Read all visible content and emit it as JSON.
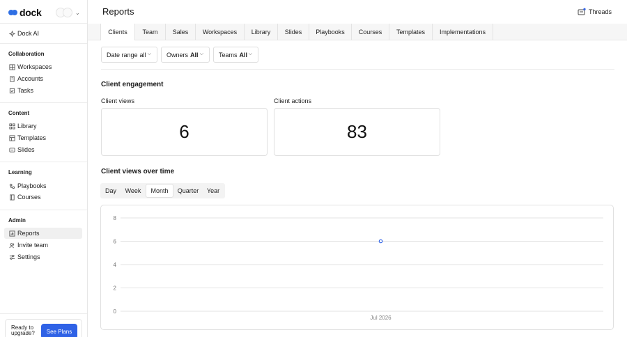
{
  "brand": {
    "name": "dock"
  },
  "sidebar": {
    "top_items": [
      {
        "label": "Dock AI",
        "icon": "sparkle-icon"
      }
    ],
    "sections": [
      {
        "heading": "Collaboration",
        "items": [
          {
            "label": "Workspaces",
            "icon": "grid-icon"
          },
          {
            "label": "Accounts",
            "icon": "building-icon"
          },
          {
            "label": "Tasks",
            "icon": "checkbox-icon"
          }
        ]
      },
      {
        "heading": "Content",
        "items": [
          {
            "label": "Library",
            "icon": "grid-icon"
          },
          {
            "label": "Templates",
            "icon": "template-icon"
          },
          {
            "label": "Slides",
            "icon": "slides-icon"
          }
        ]
      },
      {
        "heading": "Learning",
        "items": [
          {
            "label": "Playbooks",
            "icon": "playbook-icon"
          },
          {
            "label": "Courses",
            "icon": "book-icon"
          }
        ]
      },
      {
        "heading": "Admin",
        "items": [
          {
            "label": "Reports",
            "icon": "chart-icon",
            "active": true
          },
          {
            "label": "Invite team",
            "icon": "users-icon"
          },
          {
            "label": "Settings",
            "icon": "sliders-icon"
          }
        ]
      }
    ],
    "upgrade": {
      "text": "Ready to upgrade?",
      "button": "See Plans"
    }
  },
  "header": {
    "title": "Reports",
    "threads_label": "Threads"
  },
  "tabs": [
    {
      "label": "Clients",
      "active": true
    },
    {
      "label": "Team"
    },
    {
      "label": "Sales"
    },
    {
      "label": "Workspaces"
    },
    {
      "label": "Library"
    },
    {
      "label": "Slides"
    },
    {
      "label": "Playbooks"
    },
    {
      "label": "Courses"
    },
    {
      "label": "Templates"
    },
    {
      "label": "Implementations"
    }
  ],
  "filters": {
    "date_range": {
      "label": "Date range",
      "value": "all"
    },
    "owners": {
      "label": "Owners",
      "value": "All"
    },
    "teams": {
      "label": "Teams",
      "value": "All"
    }
  },
  "engagement": {
    "title": "Client engagement",
    "views_label": "Client views",
    "views_value": "6",
    "actions_label": "Client actions",
    "actions_value": "83"
  },
  "over_time": {
    "title": "Client views over time",
    "periods": [
      "Day",
      "Week",
      "Month",
      "Quarter",
      "Year"
    ],
    "selected_period": "Month"
  },
  "chart_data": {
    "type": "scatter",
    "x": [
      "Jul 2026"
    ],
    "series": [
      {
        "values": [
          6
        ]
      }
    ],
    "y_ticks": [
      0,
      2,
      4,
      6,
      8
    ],
    "ylim": [
      0,
      8
    ],
    "x_tick_labels": [
      "Jul 2026"
    ],
    "grid": true,
    "point_color": "#2f62e6"
  },
  "colors": {
    "accent": "#2f62e6",
    "border": "#e0e0e0"
  }
}
